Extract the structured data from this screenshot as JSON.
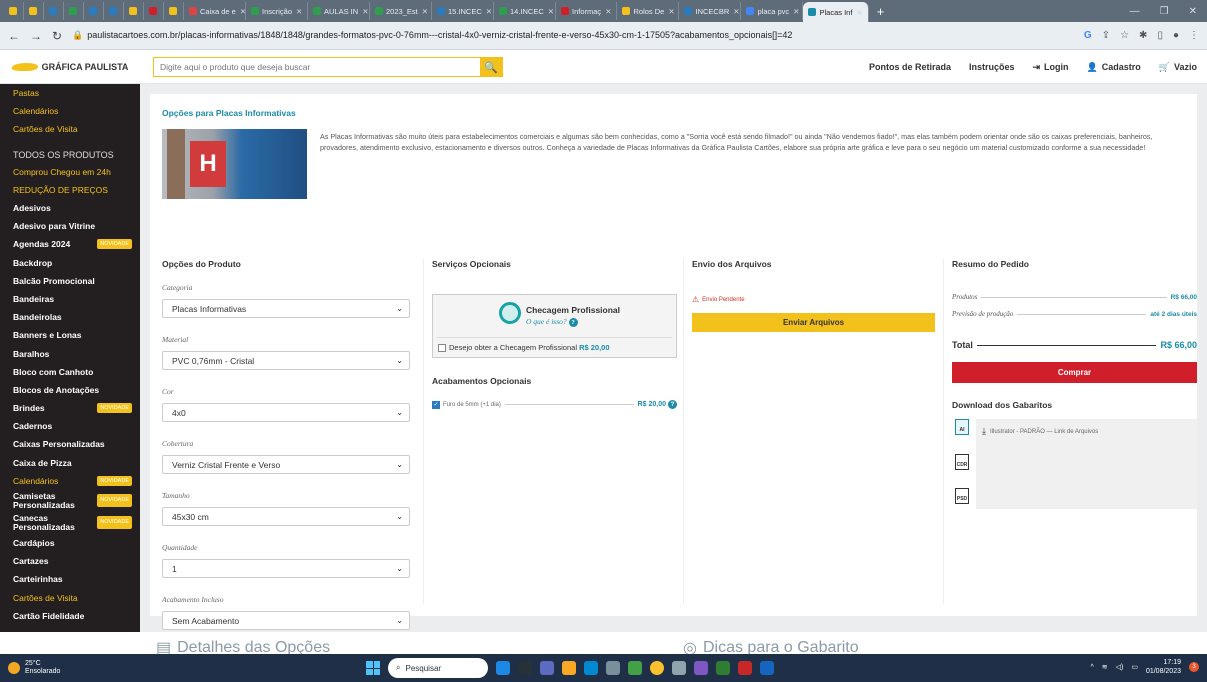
{
  "browser": {
    "tabs": [
      {
        "label": "",
        "color": "#f3c11b"
      },
      {
        "label": "",
        "color": "#f3c11b"
      },
      {
        "label": "",
        "color": "#2a7bc0"
      },
      {
        "label": "",
        "color": "#2e9e4f"
      },
      {
        "label": "",
        "color": "#2a7bc0"
      },
      {
        "label": "",
        "color": "#2a7bc0"
      },
      {
        "label": "",
        "color": "#f3c11b"
      },
      {
        "label": "",
        "color": "#d01f2a"
      },
      {
        "label": "",
        "color": "#f3c11b"
      },
      {
        "label": "Caixa de e",
        "color": "#d44"
      },
      {
        "label": "Inscrição",
        "color": "#2e9e4f"
      },
      {
        "label": "AULAS IN",
        "color": "#2e9e4f"
      },
      {
        "label": "2023_Est",
        "color": "#2e9e4f"
      },
      {
        "label": "15.INCEC",
        "color": "#2a7bc0"
      },
      {
        "label": "14.INCEC",
        "color": "#2e9e4f"
      },
      {
        "label": "Informaç",
        "color": "#d01f2a"
      },
      {
        "label": "Rolos De",
        "color": "#f3c11b"
      },
      {
        "label": "INCECBR",
        "color": "#2a7bc0"
      },
      {
        "label": "placa pvc",
        "color": "#4285f4"
      }
    ],
    "active_tab": "Placas Inf",
    "new_tab": "+",
    "url": "paulistacartoes.com.br/placas-informativas/1848/1848/grandes-formatos-pvc-0-76mm---cristal-4x0-verniz-cristal-frente-e-verso-45x30-cm-1-17505?acabamentos_opcionais[]=42"
  },
  "header": {
    "logo_text": "GRÁFICA PAULISTA",
    "search_placeholder": "Digite aqui o produto que deseja buscar",
    "nav": [
      "Pontos de Retirada",
      "Instruções",
      "Login",
      "Cadastro",
      "Vazio"
    ]
  },
  "sidebar": {
    "items": [
      {
        "label": "Pastas",
        "style": "yellow"
      },
      {
        "label": "Calendários",
        "style": "yellow"
      },
      {
        "label": "Cartões de Visita",
        "style": "yellow"
      },
      {
        "label": "TODOS OS PRODUTOS",
        "style": "head"
      },
      {
        "label": "Comprou Chegou em 24h",
        "style": "yellow"
      },
      {
        "label": "REDUÇÃO DE PREÇOS",
        "style": "yellow"
      },
      {
        "label": "Adesivos",
        "style": ""
      },
      {
        "label": "Adesivo para Vitrine",
        "style": ""
      },
      {
        "label": "Agendas 2024",
        "style": "",
        "badge": "NOVIDADE"
      },
      {
        "label": "Backdrop",
        "style": ""
      },
      {
        "label": "Balcão Promocional",
        "style": ""
      },
      {
        "label": "Bandeiras",
        "style": ""
      },
      {
        "label": "Bandeirolas",
        "style": ""
      },
      {
        "label": "Banners e Lonas",
        "style": ""
      },
      {
        "label": "Baralhos",
        "style": ""
      },
      {
        "label": "Bloco com Canhoto",
        "style": ""
      },
      {
        "label": "Blocos de Anotações",
        "style": ""
      },
      {
        "label": "Brindes",
        "style": "",
        "badge": "NOVIDADE"
      },
      {
        "label": "Cadernos",
        "style": ""
      },
      {
        "label": "Caixas Personalizadas",
        "style": ""
      },
      {
        "label": "Caixa de Pizza",
        "style": ""
      },
      {
        "label": "Calendários",
        "style": "yellow",
        "badge": "NOVIDADE"
      },
      {
        "label": "Camisetas Personalizadas",
        "style": "two",
        "badge": "NOVIDADE"
      },
      {
        "label": "Canecas Personalizadas",
        "style": "two",
        "badge": "NOVIDADE"
      },
      {
        "label": "Cardápios",
        "style": ""
      },
      {
        "label": "Cartazes",
        "style": ""
      },
      {
        "label": "Carteirinhas",
        "style": ""
      },
      {
        "label": "Cartões de Visita",
        "style": "yellow"
      },
      {
        "label": "Cartão Fidelidade",
        "style": ""
      }
    ]
  },
  "product": {
    "title": "Opções para Placas Informativas",
    "image_letter": "H",
    "description": "As Placas Informativas são muito úteis para estabelecimentos comerciais e algumas são bem conhecidas, como a \"Sorria você está sendo filmado!\" ou ainda \"Não vendemos fiado!\", mas elas também podem orientar onde são os caixas preferenciais, banheiros, provadores, atendimento exclusivo, estacionamento e diversos outros. Conheça a variedade de Placas Informativas da Gráfica Paulista Cartões, elabore sua própria arte gráfica e leve para o seu negócio um material customizado conforme a sua necessidade!"
  },
  "options": {
    "heading": "Opções do Produto",
    "fields": [
      {
        "label": "Categoria",
        "value": "Placas Informativas"
      },
      {
        "label": "Material",
        "value": "PVC 0,76mm - Cristal"
      },
      {
        "label": "Cor",
        "value": "4x0"
      },
      {
        "label": "Cobertura",
        "value": "Verniz Cristal Frente e Verso"
      },
      {
        "label": "Tamanho",
        "value": "45x30 cm"
      },
      {
        "label": "Quantidade",
        "value": "1"
      },
      {
        "label": "Acabamento Incluso",
        "value": "Sem Acabamento"
      }
    ]
  },
  "services": {
    "heading": "Serviços Opcionais",
    "check_title": "Checagem Profissional",
    "check_link": "O que é isso?",
    "check_option": "Desejo obter a Checagem Profissional",
    "check_price": "R$ 20,00",
    "finishes_heading": "Acabamentos Opcionais",
    "finish_label": "Furo de 5mm (+1 dia)",
    "finish_price": "R$ 20,00"
  },
  "upload": {
    "heading": "Envio dos Arquivos",
    "status": "Envio Pendente",
    "button": "Enviar Arquivos"
  },
  "summary": {
    "heading": "Resumo do Pedido",
    "products_label": "Produtos",
    "products_value": "R$ 66,00",
    "production_label": "Previsão de produção",
    "production_value": "até 2 dias úteis",
    "total_label": "Total",
    "total_value": "R$ 66,00",
    "buy_button": "Comprar",
    "templates_heading": "Download dos Gabaritos",
    "template_link": "Illustrator - PADRÃO — Link de Arquivos",
    "template_formats": [
      "AI",
      "CDR",
      "PSD"
    ]
  },
  "below": {
    "left": "Detalhes das Opções",
    "right": "Dicas para o Gabarito"
  },
  "taskbar": {
    "temp": "25°C",
    "weather": "Ensolarado",
    "search": "Pesquisar",
    "time": "17:19",
    "date": "01/08/2023",
    "notifications": "3"
  }
}
